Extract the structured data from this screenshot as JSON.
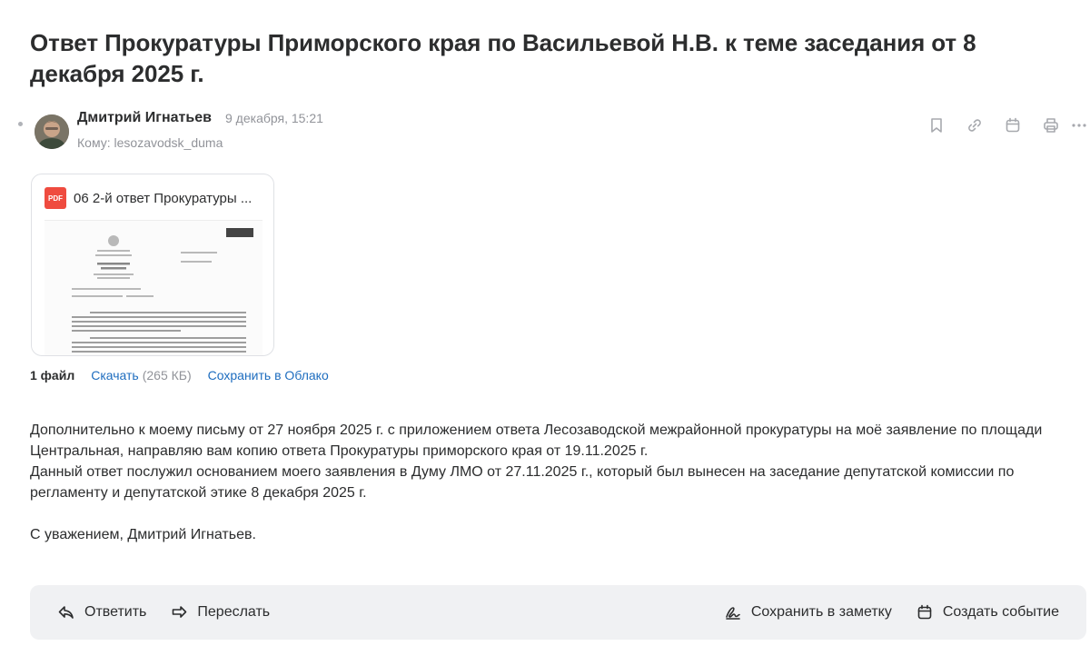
{
  "email": {
    "subject": "Ответ Прокуратуры Приморского края по Васильевой Н.В. к теме заседания от 8 декабря 2025 г.",
    "sender_name": "Дмитрий Игнатьев",
    "date": "9 декабря, 15:21",
    "to_label": "Кому:",
    "to_value": "lesozavodsk_duma"
  },
  "toolbar_icons": [
    "bookmark-icon",
    "link-icon",
    "calendar-icon",
    "print-icon",
    "more-icon"
  ],
  "attachment": {
    "type_label": "PDF",
    "name": "06 2-й ответ Прокуратуры ...",
    "count_label": "1 файл",
    "download_label": "Скачать",
    "size": "(265 КБ)",
    "save_cloud_label": "Сохранить в Облако"
  },
  "body": {
    "p1": "Дополнительно к моему письму от 27 ноября 2025 г. с приложением ответа Лесозаводской межрайонной прокуратуры на моё заявление по площади Центральная, направляю вам копию ответа Прокуратуры приморского края от 19.11.2025 г.",
    "p2": "Данный ответ послужил основанием моего заявления в Думу ЛМО от 27.11.2025 г., который был вынесен на заседание депутатской комиссии по регламенту и депутатской этике 8 декабря 2025 г.",
    "signature": "С уважением, Дмитрий Игнатьев."
  },
  "footer": {
    "reply_label": "Ответить",
    "forward_label": "Переслать",
    "save_note_label": "Сохранить в заметку",
    "create_event_label": "Создать событие"
  },
  "colors": {
    "link": "#1e6dbf",
    "pdf_red": "#ef4b3f",
    "footer_bg": "#f0f1f3",
    "muted_text": "#919399"
  }
}
